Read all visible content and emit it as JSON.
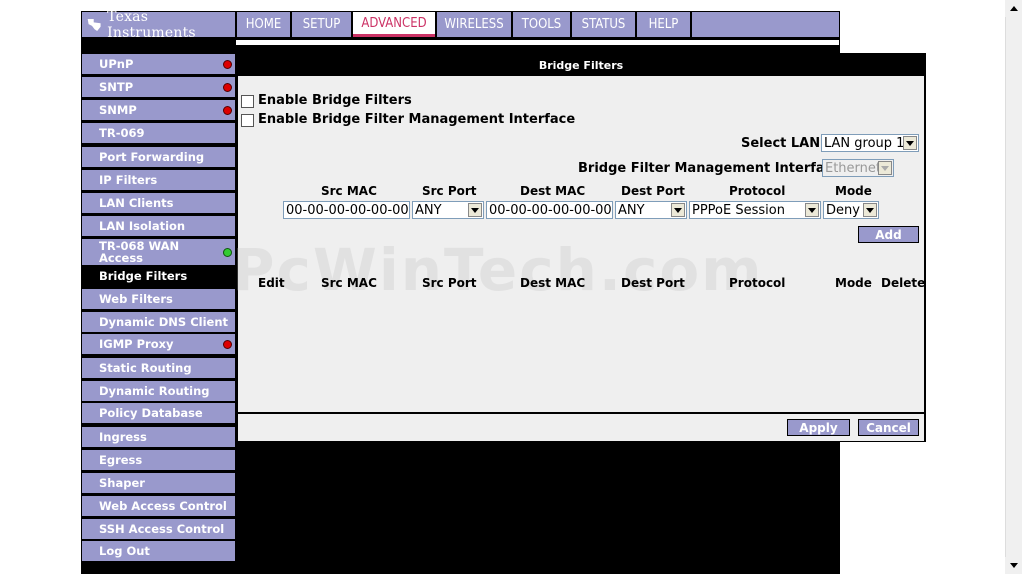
{
  "brand": {
    "name": "Texas Instruments",
    "nav_color": "#9999cc",
    "active_color": "#cc3366"
  },
  "nav": {
    "tabs": [
      {
        "label": "HOME"
      },
      {
        "label": "SETUP"
      },
      {
        "label": "ADVANCED",
        "active": true
      },
      {
        "label": "WIRELESS"
      },
      {
        "label": "TOOLS"
      },
      {
        "label": "STATUS"
      },
      {
        "label": "HELP"
      }
    ]
  },
  "sidebar": {
    "items": [
      {
        "label": "UPnP",
        "status": "red"
      },
      {
        "label": "SNTP",
        "status": "red"
      },
      {
        "label": "SNMP",
        "status": "red"
      },
      {
        "label": "TR-069"
      },
      {
        "label": "Port Forwarding"
      },
      {
        "label": "IP Filters"
      },
      {
        "label": "LAN Clients"
      },
      {
        "label": "LAN Isolation"
      },
      {
        "label": "TR-068 WAN Access",
        "status": "green"
      },
      {
        "label": "Bridge Filters",
        "active": true
      },
      {
        "label": "Web Filters"
      },
      {
        "label": "Dynamic DNS Client"
      },
      {
        "label": "IGMP Proxy",
        "status": "red"
      },
      {
        "label": "Static Routing"
      },
      {
        "label": "Dynamic Routing"
      },
      {
        "label": "Policy Database"
      },
      {
        "label": "Ingress"
      },
      {
        "label": "Egress"
      },
      {
        "label": "Shaper"
      },
      {
        "label": "Web Access Control"
      },
      {
        "label": "SSH Access Control"
      },
      {
        "label": "Log Out"
      }
    ]
  },
  "panel": {
    "title": "Bridge Filters",
    "enable_bridge_filters": {
      "label": "Enable Bridge Filters",
      "checked": false
    },
    "enable_mgmt_interface": {
      "label": "Enable Bridge Filter Management Interface",
      "checked": false
    },
    "select_lan": {
      "label": "Select LAN:",
      "value": "LAN group 1"
    },
    "mgmt_interface": {
      "label": "Bridge Filter Management Interface:",
      "value": "Ethernet"
    },
    "form_headers": [
      "Src MAC",
      "Src Port",
      "Dest MAC",
      "Dest Port",
      "Protocol",
      "Mode"
    ],
    "form": {
      "src_mac": "00-00-00-00-00-00",
      "src_port": "ANY",
      "dest_mac": "00-00-00-00-00-00",
      "dest_port": "ANY",
      "protocol": "PPPoE Session",
      "mode": "Deny"
    },
    "add_label": "Add",
    "list_headers": [
      "Edit",
      "Src MAC",
      "Src Port",
      "Dest MAC",
      "Dest Port",
      "Protocol",
      "Mode",
      "Delete"
    ],
    "apply_label": "Apply",
    "cancel_label": "Cancel"
  },
  "watermark": "PcWinTech.com"
}
